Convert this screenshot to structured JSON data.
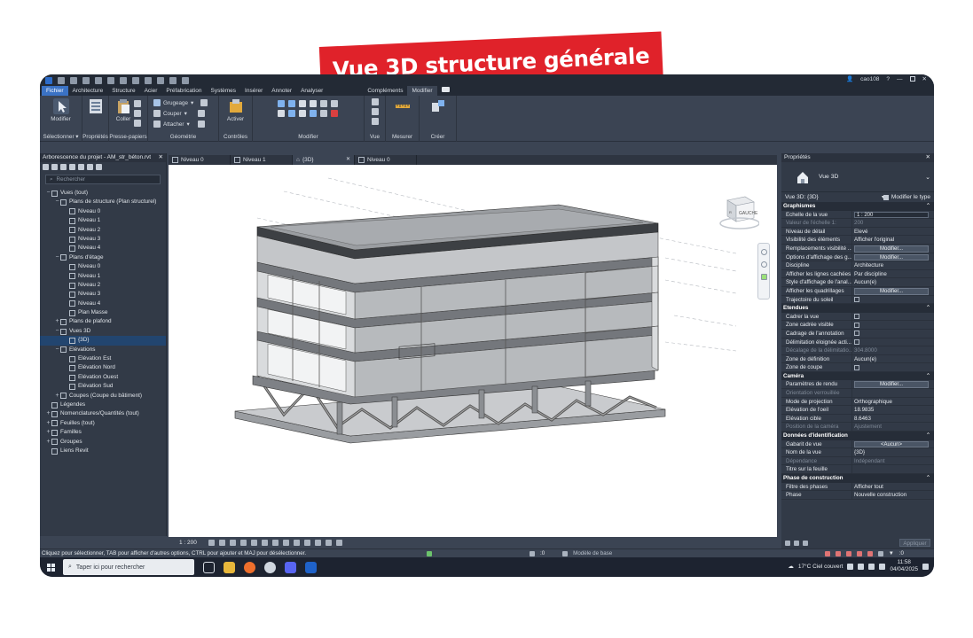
{
  "banner": {
    "text": "Vue 3D structure générale"
  },
  "titlebar": {
    "user": "cao108"
  },
  "ribbon_tabs": [
    "Fichier",
    "Architecture",
    "Structure",
    "Acier",
    "Préfabrication",
    "Systèmes",
    "Insérer",
    "Annoter",
    "Analyser",
    "Compléments",
    "Modifier"
  ],
  "ribbon": {
    "modify_label": "Modifier",
    "select_label": "Sélectionner ▾",
    "properties_label": "Propriétés",
    "paste_label": "Coller",
    "clipboard_label": "Presse-papiers",
    "geometry_items": [
      "Grugeage",
      "Couper",
      "Attacher"
    ],
    "geometry_label": "Géométrie",
    "activate_label": "Activer",
    "controls_label": "Contrôles",
    "modify_panel_label": "Modifier",
    "view_label": "Vue",
    "measure_label": "Mesurer",
    "create_label": "Créer"
  },
  "browser": {
    "title": "Arborescence du projet - AM_str_béton.rvt",
    "search_placeholder": "Rechercher",
    "tree": [
      {
        "label": "Vues (tout)",
        "toggle": "−",
        "level": 0
      },
      {
        "label": "Plans de structure (Plan structurel)",
        "toggle": "−",
        "level": 1
      },
      {
        "label": "Niveau 0",
        "toggle": "",
        "level": 2
      },
      {
        "label": "Niveau 1",
        "toggle": "",
        "level": 2
      },
      {
        "label": "Niveau 2",
        "toggle": "",
        "level": 2
      },
      {
        "label": "Niveau 3",
        "toggle": "",
        "level": 2
      },
      {
        "label": "Niveau 4",
        "toggle": "",
        "level": 2
      },
      {
        "label": "Plans d'étage",
        "toggle": "−",
        "level": 1
      },
      {
        "label": "Niveau 0",
        "toggle": "",
        "level": 2
      },
      {
        "label": "Niveau 1",
        "toggle": "",
        "level": 2
      },
      {
        "label": "Niveau 2",
        "toggle": "",
        "level": 2
      },
      {
        "label": "Niveau 3",
        "toggle": "",
        "level": 2
      },
      {
        "label": "Niveau 4",
        "toggle": "",
        "level": 2
      },
      {
        "label": "Plan Masse",
        "toggle": "",
        "level": 2
      },
      {
        "label": "Plans de plafond",
        "toggle": "+",
        "level": 1
      },
      {
        "label": "Vues 3D",
        "toggle": "−",
        "level": 1
      },
      {
        "label": "{3D}",
        "toggle": "",
        "level": 2,
        "selected": true
      },
      {
        "label": "Elévations",
        "toggle": "−",
        "level": 1
      },
      {
        "label": "Elévation Est",
        "toggle": "",
        "level": 2
      },
      {
        "label": "Elévation Nord",
        "toggle": "",
        "level": 2
      },
      {
        "label": "Elévation Ouest",
        "toggle": "",
        "level": 2
      },
      {
        "label": "Elévation Sud",
        "toggle": "",
        "level": 2
      },
      {
        "label": "Coupes (Coupe du bâtiment)",
        "toggle": "+",
        "level": 1
      },
      {
        "label": "Légendes",
        "toggle": "",
        "level": 0
      },
      {
        "label": "Nomenclatures/Quantités (tout)",
        "toggle": "+",
        "level": 0
      },
      {
        "label": "Feuilles (tout)",
        "toggle": "+",
        "level": 0
      },
      {
        "label": "Familles",
        "toggle": "+",
        "level": 0
      },
      {
        "label": "Groupes",
        "toggle": "+",
        "level": 0
      },
      {
        "label": "Liens Revit",
        "toggle": "",
        "level": 0
      }
    ]
  },
  "view_tabs": [
    {
      "label": "Niveau 0",
      "active": false
    },
    {
      "label": "Niveau 1",
      "active": false
    },
    {
      "label": "{3D}",
      "active": true
    },
    {
      "label": "Niveau 0",
      "active": false
    }
  ],
  "viewcube": {
    "face_label": "GAUCHE"
  },
  "view_control": {
    "scale": "1 : 200"
  },
  "properties": {
    "title": "Propriétés",
    "type_name": "Vue 3D",
    "view_selector": "Vue 3D: {3D}",
    "edit_type": "Modifier le type",
    "sections": [
      {
        "name": "Graphismes",
        "rows": [
          {
            "k": "Echelle de la vue",
            "v": "1 : 200",
            "kind": "box"
          },
          {
            "k": "Valeur de l'échelle   1:",
            "v": "200",
            "kind": "dis"
          },
          {
            "k": "Niveau de détail",
            "v": "Elevé",
            "kind": "text"
          },
          {
            "k": "Visibilité des éléments",
            "v": "Afficher l'original",
            "kind": "text"
          },
          {
            "k": "Remplacements visibilité ...",
            "v": "Modifier...",
            "kind": "btn"
          },
          {
            "k": "Options d'affichage des g...",
            "v": "Modifier...",
            "kind": "btn"
          },
          {
            "k": "Discipline",
            "v": "Architecture",
            "kind": "text"
          },
          {
            "k": "Afficher les lignes cachées",
            "v": "Par discipline",
            "kind": "text"
          },
          {
            "k": "Style d'affichage de l'anal...",
            "v": "Aucun(e)",
            "kind": "text"
          },
          {
            "k": "Afficher les quadrillages",
            "v": "Modifier...",
            "kind": "btn"
          },
          {
            "k": "Trajectoire du soleil",
            "v": "",
            "kind": "cb"
          }
        ]
      },
      {
        "name": "Etendues",
        "rows": [
          {
            "k": "Cadrer la vue",
            "v": "",
            "kind": "cb"
          },
          {
            "k": "Zone cadrée visible",
            "v": "",
            "kind": "cb"
          },
          {
            "k": "Cadrage de l'annotation",
            "v": "",
            "kind": "cb"
          },
          {
            "k": "Délimitation éloignée acti...",
            "v": "",
            "kind": "cb"
          },
          {
            "k": "Décalage de la délimitatio...",
            "v": "304.8000",
            "kind": "dis"
          },
          {
            "k": "Zone de définition",
            "v": "Aucun(e)",
            "kind": "text"
          },
          {
            "k": "Zone de coupe",
            "v": "",
            "kind": "cb"
          }
        ]
      },
      {
        "name": "Caméra",
        "rows": [
          {
            "k": "Paramètres de rendu",
            "v": "Modifier...",
            "kind": "btn"
          },
          {
            "k": "Orientation verrouillée",
            "v": "",
            "kind": "dis"
          },
          {
            "k": "Mode de projection",
            "v": "Orthographique",
            "kind": "text"
          },
          {
            "k": "Elévation de l'oeil",
            "v": "18.9835",
            "kind": "text"
          },
          {
            "k": "Elévation cible",
            "v": "8.6463",
            "kind": "text"
          },
          {
            "k": "Position de la caméra",
            "v": "Ajustement",
            "kind": "dis"
          }
        ]
      },
      {
        "name": "Données d'identification",
        "rows": [
          {
            "k": "Gabarit de vue",
            "v": "<Aucun>",
            "kind": "btn"
          },
          {
            "k": "Nom de la vue",
            "v": "{3D}",
            "kind": "text"
          },
          {
            "k": "Dépendance",
            "v": "Indépendant",
            "kind": "dis"
          },
          {
            "k": "Titre sur la feuille",
            "v": "",
            "kind": "text"
          }
        ]
      },
      {
        "name": "Phase de construction",
        "rows": [
          {
            "k": "Filtre des phases",
            "v": "Afficher tout",
            "kind": "text"
          },
          {
            "k": "Phase",
            "v": "Nouvelle construction",
            "kind": "text"
          }
        ]
      }
    ],
    "apply_label": "Appliquer"
  },
  "status": {
    "hint": "Cliquez pour sélectionner, TAB pour afficher d'autres options,  CTRL pour ajouter et MAJ pour désélectionner.",
    "zero_a": ":0",
    "model": "Modèle de base",
    "zero_b": ":0"
  },
  "taskbar": {
    "search_placeholder": "Taper ici pour rechercher",
    "weather": "17°C  Ciel couvert",
    "time": "11:58",
    "date": "04/04/2025"
  },
  "colors": {
    "accent": "#3a72c4",
    "banner": "#e0222a",
    "panel": "#3b4453",
    "viewport": "#ffffff"
  }
}
